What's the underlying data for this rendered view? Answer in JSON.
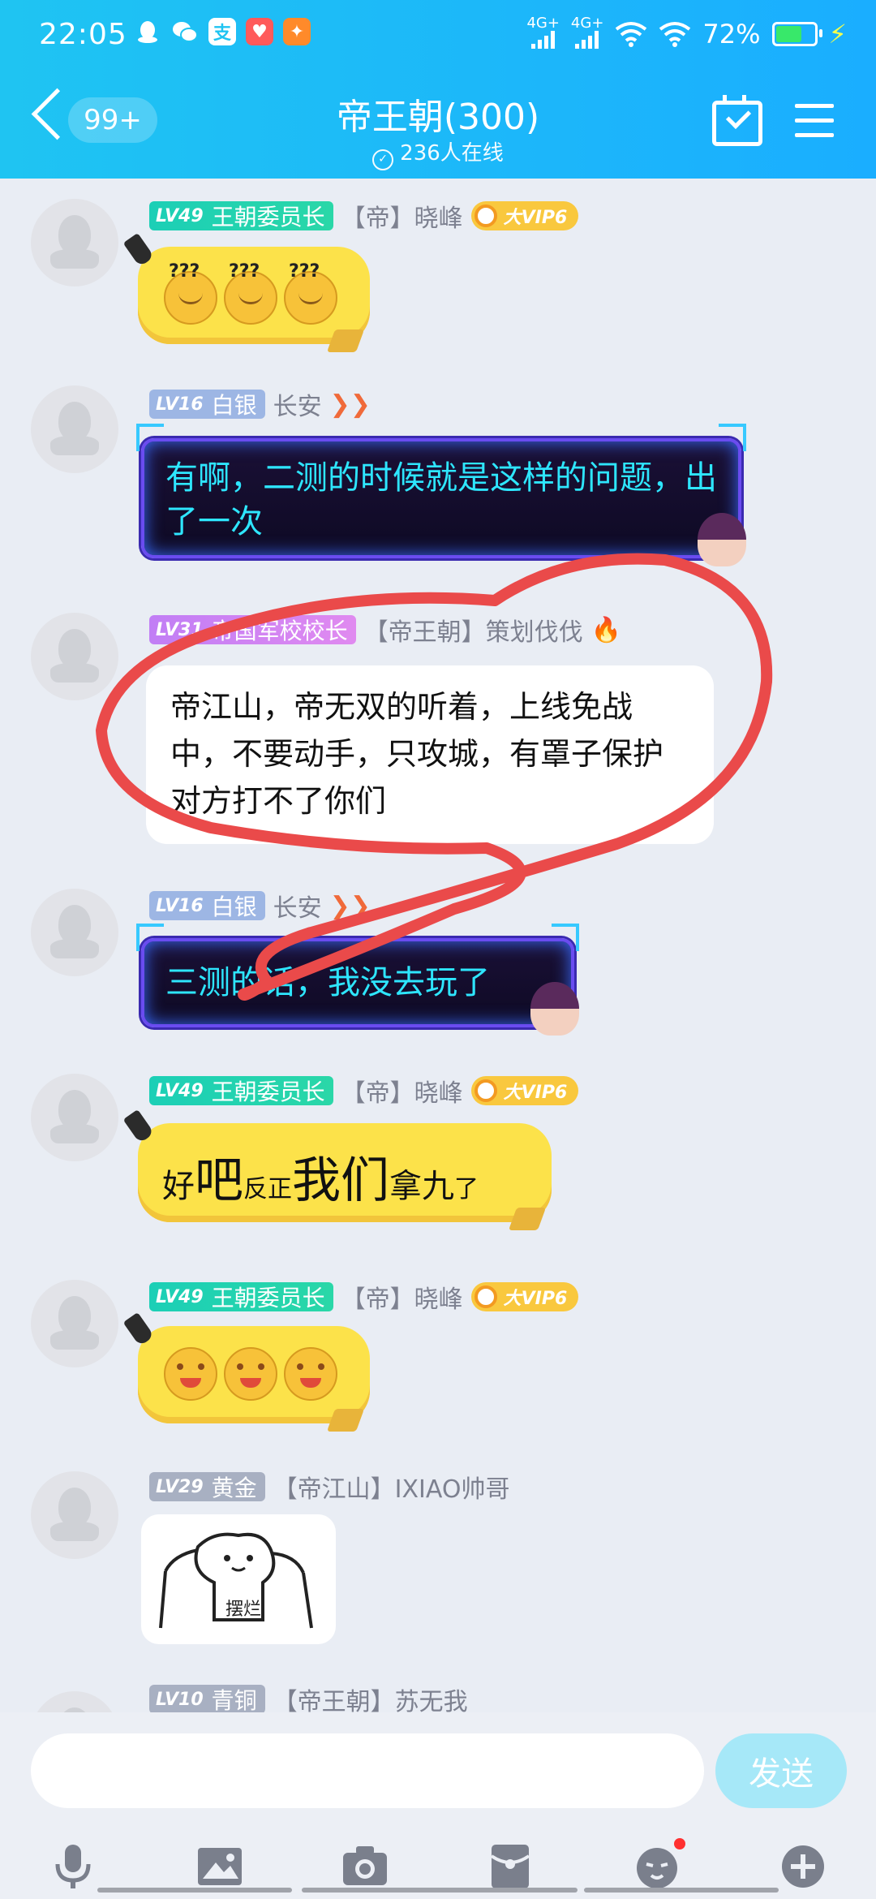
{
  "status_bar": {
    "time": "22:05",
    "network_1": "4G+",
    "network_2": "4G+",
    "battery": "72%",
    "battery_level": 0.72,
    "notification_icons": [
      "qq-icon",
      "wechat-icon",
      "app-icon",
      "heart-app-icon",
      "game-app-icon"
    ]
  },
  "header": {
    "back_count": "99+",
    "title": "帝王朝(300)",
    "online": "236人在线"
  },
  "messages": [
    {
      "level": "LV49",
      "rank": "王朝委员长",
      "tag": "【帝】晓峰",
      "vip": "大VIP6",
      "content": [
        "???",
        "???",
        "???"
      ]
    },
    {
      "level": "LV16",
      "rank": "白银",
      "tag": "长安",
      "content": "有啊，二测的时候就是这样的问题，出了一次"
    },
    {
      "level": "LV31",
      "rank": "帝国军校校长",
      "tag": "【帝王朝】策划伐伐",
      "content": "帝江山，帝无双的听着，上线免战中，不要动手，只攻城，有罩子保护对方打不了你们"
    },
    {
      "level": "LV16",
      "rank": "白银",
      "tag": "长安",
      "content": "三测的话，我没去玩了"
    },
    {
      "level": "LV49",
      "rank": "王朝委员长",
      "tag": "【帝】晓峰",
      "vip": "大VIP6",
      "content_parts": [
        "好",
        "吧",
        "反正",
        "我们",
        "拿九",
        "了"
      ]
    },
    {
      "level": "LV49",
      "rank": "王朝委员长",
      "tag": "【帝】晓峰",
      "vip": "大VIP6"
    },
    {
      "level": "LV29",
      "rank": "黄金",
      "tag": "【帝江山】IXIAO帅哥",
      "sticker_text": "摆烂"
    },
    {
      "level": "LV10",
      "rank": "青铜",
      "tag": "【帝王朝】苏无我"
    }
  ],
  "input": {
    "send_label": "发送",
    "placeholder": ""
  },
  "toolbar": [
    "microphone-icon",
    "image-icon",
    "camera-icon",
    "red-packet-icon",
    "emoji-icon",
    "plus-icon"
  ],
  "colors": {
    "header": "#1fc4f2",
    "background": "#e9edf4",
    "annotation": "#ea4a4a",
    "send_button": "#a6e8f8"
  }
}
